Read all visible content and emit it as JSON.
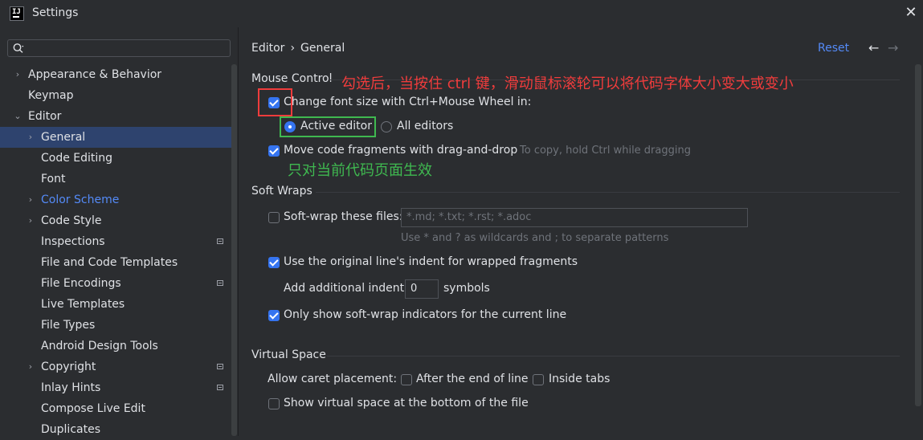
{
  "window": {
    "title": "Settings",
    "logo": "IJ"
  },
  "search": {
    "placeholder": ""
  },
  "sidebar": {
    "items": [
      {
        "label": "Appearance & Behavior",
        "chevron": "›"
      },
      {
        "label": "Keymap"
      },
      {
        "label": "Editor",
        "chevron": "⌄"
      },
      {
        "label": "General",
        "chevron": "›"
      },
      {
        "label": "Code Editing"
      },
      {
        "label": "Font"
      },
      {
        "label": "Color Scheme",
        "chevron": "›"
      },
      {
        "label": "Code Style",
        "chevron": "›"
      },
      {
        "label": "Inspections"
      },
      {
        "label": "File and Code Templates"
      },
      {
        "label": "File Encodings"
      },
      {
        "label": "Live Templates"
      },
      {
        "label": "File Types"
      },
      {
        "label": "Android Design Tools"
      },
      {
        "label": "Copyright",
        "chevron": "›"
      },
      {
        "label": "Inlay Hints"
      },
      {
        "label": "Compose Live Edit"
      },
      {
        "label": "Duplicates"
      }
    ]
  },
  "header": {
    "breadcrumb": [
      "Editor",
      "General"
    ],
    "breadcrumb_sep": "›",
    "reset": "Reset",
    "back": "←",
    "forward": "→"
  },
  "mouse_control": {
    "title": "Mouse Control",
    "change_font_size": "Change font size with Ctrl+Mouse Wheel in:",
    "active_editor": "Active editor",
    "all_editors": "All editors",
    "move_fragments": "Move code fragments with drag-and-drop",
    "move_hint": "To copy, hold Ctrl while dragging"
  },
  "soft_wraps": {
    "title": "Soft Wraps",
    "soft_wrap_files": "Soft-wrap these files:",
    "files_placeholder": "*.md; *.txt; *.rst; *.adoc",
    "wildcard_hint": "Use * and ? as wildcards and ; to separate patterns",
    "use_original_indent": "Use the original line's indent for wrapped fragments",
    "add_indent_label": "Add additional indent:",
    "add_indent_value": "0",
    "symbols": "symbols",
    "only_show_indicators": "Only show soft-wrap indicators for the current line"
  },
  "virtual_space": {
    "title": "Virtual Space",
    "caret_label": "Allow caret placement:",
    "after_end": "After the end of line",
    "inside_tabs": "Inside tabs",
    "show_virtual_space": "Show virtual space at the bottom of the file"
  },
  "annotations": {
    "red_note": "勾选后，当按住 ctrl 键，滑动鼠标滚轮可以将代码字体大小变大或变小",
    "green_note": "只对当前代码页面生效"
  },
  "colors": {
    "background": "#2b2d30",
    "accent": "#3574f0",
    "link": "#548af7",
    "selection": "#2e436e",
    "annotation_red": "#f03c3c",
    "annotation_green": "#3fb950"
  }
}
